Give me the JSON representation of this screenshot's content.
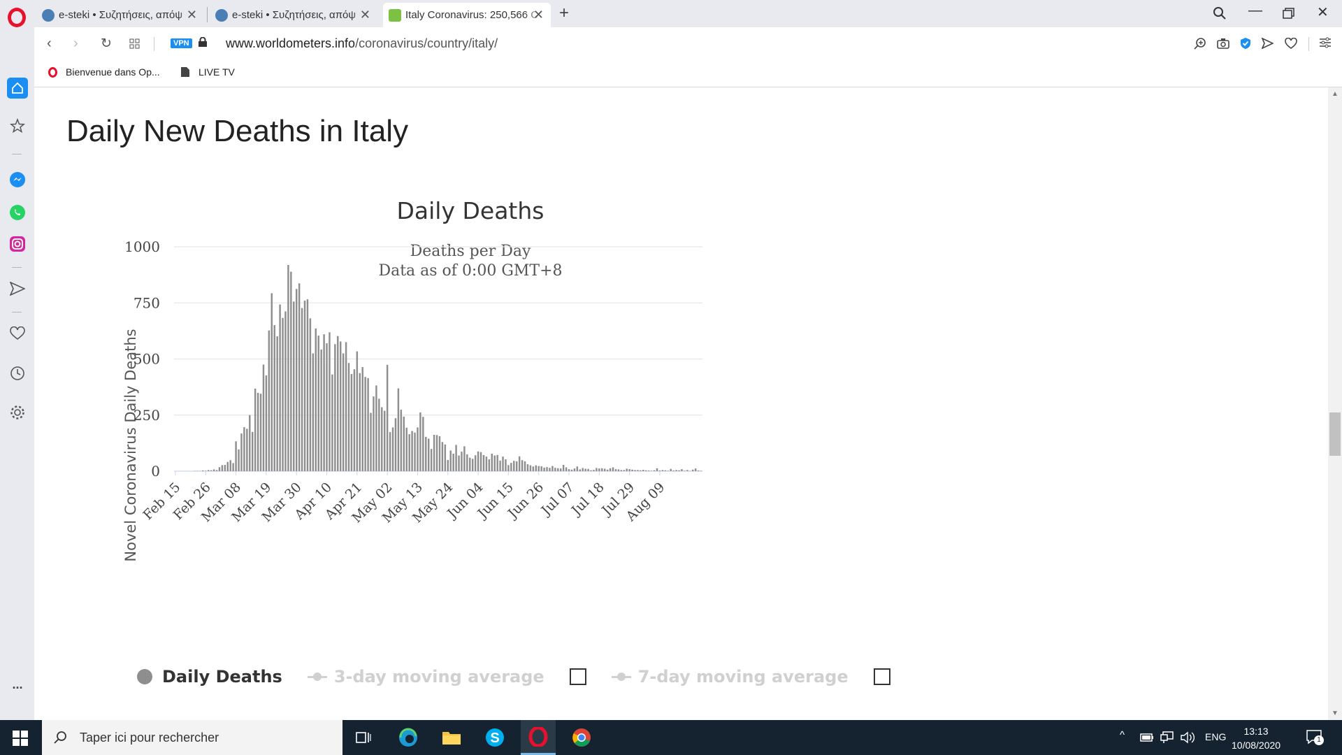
{
  "browser": {
    "tabs": [
      {
        "title": "e-steki • Συζητήσεις, απόψ",
        "active": false
      },
      {
        "title": "e-steki • Συζητήσεις, απόψ",
        "active": false
      },
      {
        "title": "Italy Coronavirus: 250,566 C",
        "active": true
      }
    ],
    "url_host": "www.worldometers.info",
    "url_path": "/coronavirus/country/italy/",
    "vpn_label": "VPN",
    "bookmarks": [
      {
        "label": "Bienvenue dans Op..."
      },
      {
        "label": "LIVE TV"
      }
    ],
    "sidebar_more": "..."
  },
  "page": {
    "heading": "Daily New Deaths in Italy"
  },
  "chart_data": {
    "type": "bar",
    "title": "Daily Deaths",
    "subtitle_lines": [
      "Deaths per Day",
      "Data as of 0:00 GMT+8"
    ],
    "ylabel": "Novel Coronavirus Daily Deaths",
    "xlabel": "",
    "ylim": [
      0,
      1000
    ],
    "yticks": [
      0,
      250,
      500,
      750,
      1000
    ],
    "xtick_labels": [
      "Feb 15",
      "Feb 26",
      "Mar 08",
      "Mar 19",
      "Mar 30",
      "Apr 10",
      "Apr 21",
      "May 02",
      "May 13",
      "May 24",
      "Jun 04",
      "Jun 15",
      "Jun 26",
      "Jul 07",
      "Jul 18",
      "Jul 29",
      "Aug 09"
    ],
    "start_date": "Feb 15",
    "end_date": "Aug 09",
    "grid": true,
    "series": [
      {
        "name": "Daily Deaths",
        "color": "#8e8e8e",
        "values": [
          0,
          0,
          0,
          0,
          0,
          0,
          0,
          1,
          1,
          1,
          3,
          2,
          5,
          4,
          8,
          5,
          18,
          27,
          28,
          41,
          49,
          36,
          133,
          97,
          168,
          196,
          189,
          250,
          175,
          368,
          349,
          345,
          475,
          427,
          627,
          793,
          651,
          601,
          743,
          683,
          712,
          919,
          889,
          756,
          812,
          837,
          727,
          760,
          766,
          681,
          525,
          636,
          604,
          542,
          610,
          570,
          619,
          431,
          566,
          602,
          578,
          525,
          575,
          482,
          433,
          454,
          534,
          437,
          464,
          420,
          415,
          260,
          333,
          382,
          323,
          285,
          269,
          474,
          174,
          195,
          236,
          369,
          274,
          243,
          194,
          165,
          179,
          172,
          195,
          262,
          242,
          153,
          145,
          99,
          162,
          161,
          156,
          130,
          119,
          50,
          92,
          78,
          117,
          70,
          87,
          111,
          75,
          60,
          55,
          71,
          88,
          85,
          72,
          65,
          53,
          78,
          70,
          72,
          47,
          65,
          53,
          27,
          37,
          46,
          44,
          66,
          49,
          44,
          31,
          26,
          21,
          26,
          23,
          22,
          16,
          18,
          15,
          23,
          15,
          13,
          12,
          28,
          17,
          9,
          7,
          12,
          21,
          8,
          14,
          11,
          10,
          4,
          6,
          14,
          12,
          13,
          11,
          7,
          13,
          17,
          9,
          8,
          5,
          5,
          11,
          9,
          7,
          5,
          5,
          4,
          6,
          4,
          3,
          2,
          4,
          13,
          3,
          5,
          4,
          2,
          10,
          3,
          5,
          4,
          9,
          2,
          5,
          1,
          7,
          12,
          3,
          2
        ]
      },
      {
        "name": "3-day moving average",
        "color": "#d0d0d0",
        "visible": false
      },
      {
        "name": "7-day moving average",
        "color": "#d0d0d0",
        "visible": false
      }
    ],
    "legend_position": "bottom"
  },
  "taskbar": {
    "search_placeholder": "Taper ici pour rechercher",
    "language": "ENG",
    "time": "13:13",
    "date": "10/08/2020",
    "notification_count": "1"
  }
}
